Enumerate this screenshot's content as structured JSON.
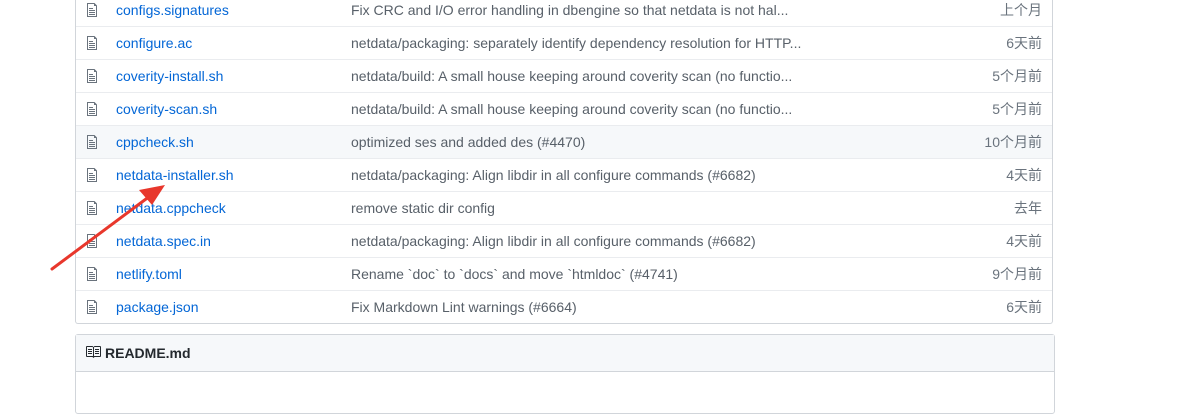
{
  "files": [
    {
      "name": "configs.signatures",
      "message": "Fix CRC and I/O error handling in dbengine so that netdata is not hal...",
      "age": "上个月"
    },
    {
      "name": "configure.ac",
      "message": "netdata/packaging: separately identify dependency resolution for HTTP...",
      "age": "6天前"
    },
    {
      "name": "coverity-install.sh",
      "message": "netdata/build: A small house keeping around coverity scan (no functio...",
      "age": "5个月前"
    },
    {
      "name": "coverity-scan.sh",
      "message": "netdata/build: A small house keeping around coverity scan (no functio...",
      "age": "5个月前"
    },
    {
      "name": "cppcheck.sh",
      "message": "optimized ses and added des (#4470)",
      "age": "10个月前"
    },
    {
      "name": "netdata-installer.sh",
      "message": "netdata/packaging: Align libdir in all configure commands (#6682)",
      "age": "4天前"
    },
    {
      "name": "netdata.cppcheck",
      "message": "remove static dir config",
      "age": "去年"
    },
    {
      "name": "netdata.spec.in",
      "message": "netdata/packaging: Align libdir in all configure commands (#6682)",
      "age": "4天前"
    },
    {
      "name": "netlify.toml",
      "message": "Rename `doc` to `docs` and move `htmldoc` (#4741)",
      "age": "9个月前"
    },
    {
      "name": "package.json",
      "message": "Fix Markdown Lint warnings (#6664)",
      "age": "6天前"
    }
  ],
  "readme": {
    "title": "README.md"
  },
  "icons": {
    "file": "file-icon",
    "readme": "book-icon"
  },
  "colors": {
    "link": "#0366d6",
    "annotation_arrow": "#e8372c"
  }
}
